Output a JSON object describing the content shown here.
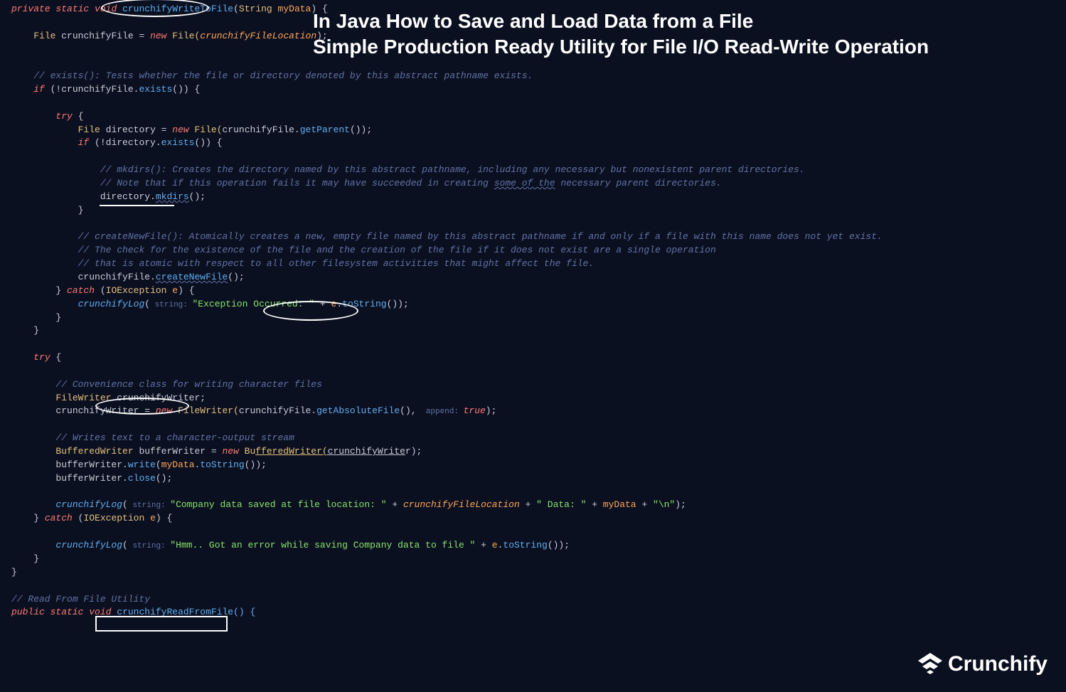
{
  "title": {
    "line1": "In Java How to Save and Load Data from a File",
    "line2": "Simple Production Ready Utility for File I/O Read-Write Operation"
  },
  "code": {
    "l01_kw_private": "private",
    "l01_kw_static": "static",
    "l01_kw_void": "void",
    "l01_method": "crunchifyWriteToFile",
    "l01_paramType": "String",
    "l01_paramName": "myData",
    "l01_brace": ") {",
    "l03_type_File": "File",
    "l03_var": "crunchifyFile",
    "l03_eq": " = ",
    "l03_new": "new",
    "l03_File": " File(",
    "l03_arg": "crunchifyFileLocation",
    "l03_end": ");",
    "l06_cmt": "// exists(): Tests whether the file or directory denoted by this abstract pathname exists.",
    "l07_if": "if",
    "l07_rest1": " (!",
    "l07_obj": "crunchifyFile",
    "l07_dot": ".",
    "l07_fn": "exists",
    "l07_rest2": "()) {",
    "l09_try": "try",
    "l09_brace": " {",
    "l10_type_File": "File",
    "l10_var": "directory",
    "l10_rest1": " = ",
    "l10_new": "new",
    "l10_File": " File(",
    "l10_obj": "crunchifyFile",
    "l10_dot": ".",
    "l10_fn": "getParent",
    "l10_rest2": "());",
    "l11_if": "if",
    "l11_rest1": " (!",
    "l11_obj": "directory",
    "l11_dot": ".",
    "l11_fn": "exists",
    "l11_rest2": "()) {",
    "l13_cmt": "// mkdirs(): Creates the directory named by this abstract pathname, including any necessary but nonexistent parent directories.",
    "l14_cmt1": "// Note that if this operation fails it may have succeeded in creating ",
    "l14_cmt_u": "some of the",
    "l14_cmt2": " necessary parent directories.",
    "l15_obj": "directory",
    "l15_dot": ".",
    "l15_fn": "mkdirs",
    "l15_end": "();",
    "l16_brace": "}",
    "l18_cmt": "// createNewFile(): Atomically creates a new, empty file named by this abstract pathname if and only if a file with this name does not yet exist.",
    "l19_cmt": "// The check for the existence of the file and the creation of the file if it does not exist are a single operation",
    "l20_cmt": "// that is atomic with respect to all other filesystem activities that might affect the file.",
    "l21_obj": "crunchifyFile",
    "l21_dot": ".",
    "l21_fn": "createNewFile",
    "l21_end": "();",
    "l22_brace": "} ",
    "l22_catch": "catch",
    "l22_paren": " (",
    "l22_type": "IOException",
    "l22_var": " e",
    "l22_rest": ") {",
    "l23_fn": "crunchifyLog",
    "l23_paren": "(",
    "l23_hint": " string: ",
    "l23_str": "\"Exception Occurred: \"",
    "l23_plus": " + ",
    "l23_e": "e",
    "l23_dot": ".",
    "l23_toStr": "toString",
    "l23_end": "());",
    "l24_brace": "}",
    "l25_brace": "}",
    "l27_try": "try",
    "l27_brace": " {",
    "l29_cmt": "// Convenience class for writing character files",
    "l30_type": "FileWriter",
    "l30_var": " crunchifyWriter;",
    "l31_var": "crunchifyWriter",
    "l31_eq": " = ",
    "l31_new": "new",
    "l31_type": " FileWriter(",
    "l31_obj": "crunchifyFile",
    "l31_dot": ".",
    "l31_fn": "getAbsoluteFile",
    "l31_paren": "(),",
    "l31_hint": "  append: ",
    "l31_bool": "true",
    "l31_end": ");",
    "l33_cmt": "// Writes text to a character-output stream",
    "l34_type": "BufferedWriter",
    "l34_var": " bufferWriter",
    "l34_eq": " = ",
    "l34_new": "new",
    "l34_bw1": " Bu",
    "l34_bw2": "fferedWriter(",
    "l34_arg": "crunchifyWrite",
    "l34_arg2": "r",
    "l34_end": ");",
    "l35_obj": "bufferWriter",
    "l35_dot": ".",
    "l35_fn": "write",
    "l35_paren": "(",
    "l35_arg": "myData",
    "l35_dot2": ".",
    "l35_toStr": "toString",
    "l35_end": "());",
    "l36_obj": "bufferWriter",
    "l36_dot": ".",
    "l36_fn": "close",
    "l36_end": "();",
    "l38_fn": "crunchifyLog",
    "l38_paren": "(",
    "l38_hint": " string: ",
    "l38_str1": "\"Company data saved at file location: \"",
    "l38_plus1": " + ",
    "l38_var1": "crunchifyFileLocation",
    "l38_plus2": " + ",
    "l38_str2": "\" Data: \"",
    "l38_plus3": " + ",
    "l38_var2": "myData",
    "l38_plus4": " + ",
    "l38_str3": "\"\\n\"",
    "l38_end": ");",
    "l39_brace": "} ",
    "l39_catch": "catch",
    "l39_paren": " (",
    "l39_type": "IOException",
    "l39_var": " e",
    "l39_rest": ") {",
    "l41_fn": "crunchifyLog",
    "l41_paren": "(",
    "l41_hint": " string: ",
    "l41_str": "\"Hmm.. Got an error while saving Company data to file \"",
    "l41_plus": " + ",
    "l41_e": "e",
    "l41_dot": ".",
    "l41_toStr": "toString",
    "l41_end": "());",
    "l42_brace": "}",
    "l43_brace": "}",
    "l45_cmt": "// Read From File Utility",
    "l46_public": "public",
    "l46_static": "static",
    "l46_void": "void",
    "l46_method": " crunchifyReadFromFile() {"
  },
  "logo": "Crunchify"
}
